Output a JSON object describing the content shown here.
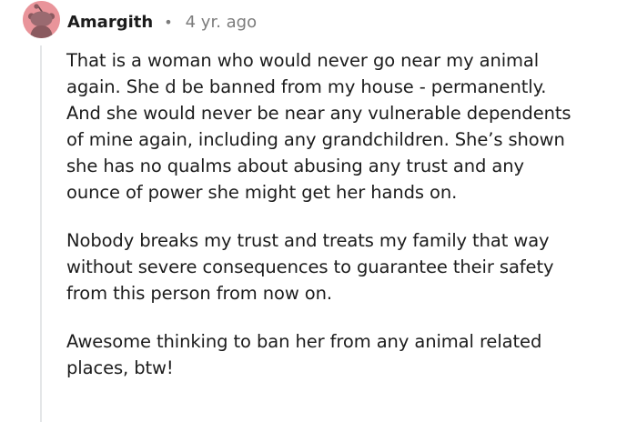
{
  "comment": {
    "username": "Amargith",
    "separator": "•",
    "age": "4 yr. ago",
    "paragraphs": [
      [
        "That is a woman who would never go near my animal",
        "again. She d be banned from my house - permanently.",
        "And she would never be near any vulnerable dependents",
        "of mine again, including any grandchildren. She’s shown",
        "she has no qualms about abusing any trust and any",
        "ounce of power she might get her hands on."
      ],
      [
        "Nobody breaks my trust and treats my family that way",
        "without severe consequences to guarantee their safety",
        "from this person from now on."
      ],
      [
        "Awesome thinking to ban her from any animal related",
        "places, btw!"
      ]
    ]
  },
  "icons": {
    "avatar": "snoo-avatar-icon"
  },
  "colors": {
    "avatar_bg": "#e9949a",
    "text": "#1c1c1c",
    "meta_text": "#7c7c7c",
    "thread_line": "#e4e6e8"
  }
}
